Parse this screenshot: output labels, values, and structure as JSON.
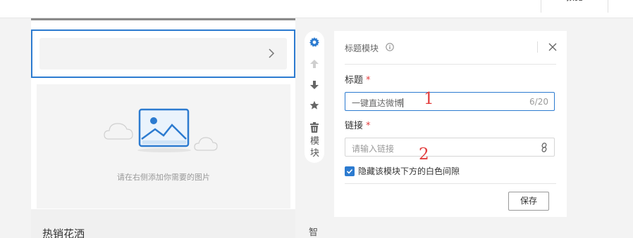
{
  "topbar": {
    "partial_tab_label": "预览"
  },
  "preview": {
    "image_placeholder_caption": "请在右侧添加你需要的图片",
    "section_title": "热销花洒"
  },
  "toolbar": {
    "icons": [
      "gear-icon",
      "arrow-up-icon",
      "arrow-down-icon",
      "star-icon",
      "trash-icon"
    ],
    "side_text": [
      "模",
      "块"
    ],
    "below_char": "智"
  },
  "panel": {
    "title": "标题模块",
    "title_field": {
      "label": "标题",
      "required_mark": "*",
      "value": "一键直达微博",
      "counter": "6/20"
    },
    "link_field": {
      "label": "链接",
      "required_mark": "*",
      "placeholder": "请输入链接"
    },
    "hide_gap_checkbox": {
      "label": "隐藏该模块下方的白色间隙",
      "checked": true
    },
    "save_label": "保存"
  },
  "annotations": {
    "first": "1",
    "second": "2"
  },
  "colors": {
    "accent": "#2c7bd0",
    "required": "#e23c3c",
    "annotation": "#e23c3c"
  }
}
